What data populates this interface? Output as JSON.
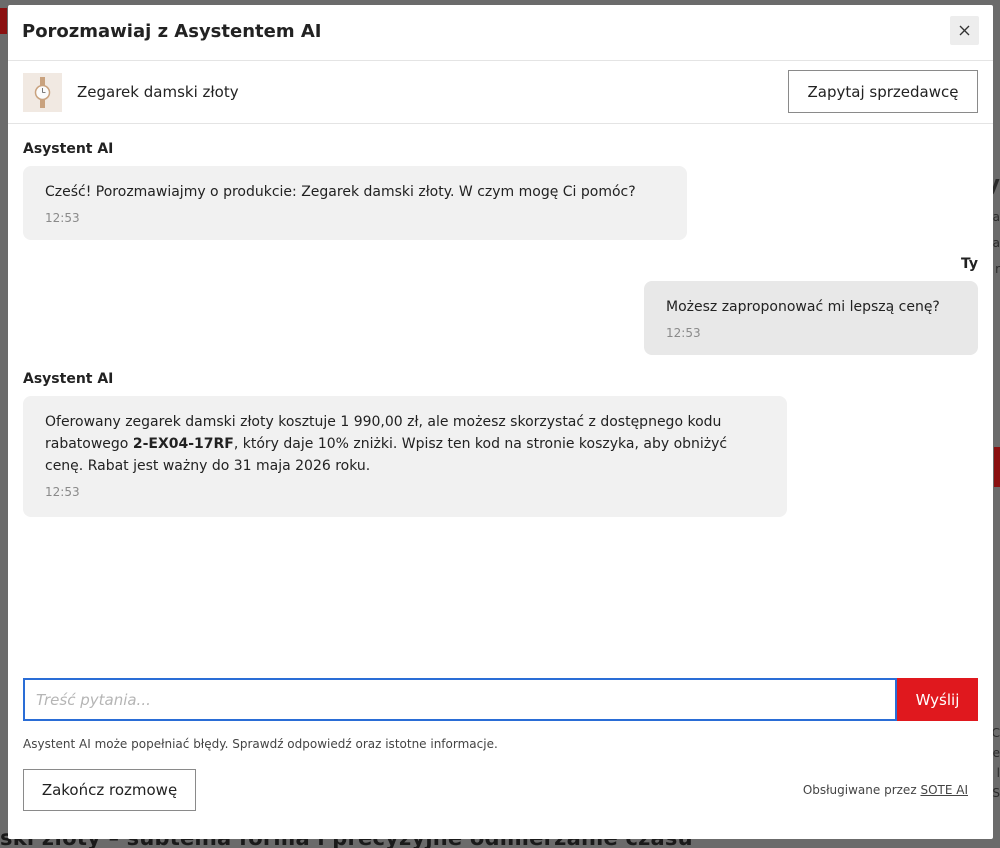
{
  "modal": {
    "title": "Porozmawiaj z Asystentem AI",
    "close_icon": "close-icon"
  },
  "product": {
    "thumbnail_icon": "watch-thumbnail",
    "name": "Zegarek damski złoty",
    "ask_seller_label": "Zapytaj sprzedawcę"
  },
  "messages": [
    {
      "sender": "Asystent AI",
      "text": "Cześć! Porozmawiajmy o produkcie: Zegarek damski złoty. W czym mogę Ci pomóc?",
      "time": "12:53"
    },
    {
      "sender": "Ty",
      "text": "Możesz zaproponować mi lepszą cenę?",
      "time": "12:53"
    },
    {
      "sender": "Asystent AI",
      "text_before": "Oferowany zegarek damski złoty kosztuje 1 990,00 zł, ale możesz skorzystać z dostępnego kodu rabatowego ",
      "code": "2-EX04-17RF",
      "text_after": ", który daje 10% zniżki. Wpisz ten kod na stronie koszyka, aby obniżyć cenę. Rabat jest ważny do 31 maja 2026 roku.",
      "time": "12:53"
    }
  ],
  "input": {
    "placeholder": "Treść pytania...",
    "value": "",
    "send_label": "Wyślij"
  },
  "footer": {
    "disclaimer": "Asystent AI może popełniać błędy. Sprawdź odpowiedź oraz istotne informacje.",
    "end_chat_label": "Zakończ rozmowę",
    "powered_by_prefix": "Obsługiwane przez",
    "powered_by_link": "SOTE AI"
  },
  "background": {
    "bottom_text": "ski złoty – subtelna forma i precyzyjne odmierzanie czasu",
    "right_fragments": [
      "y",
      "a",
      "a",
      "r",
      "C",
      "e",
      "l",
      "S",
      "t",
      "e",
      "e"
    ]
  },
  "colors": {
    "accent_red": "#e0181e",
    "focus_blue": "#2a6dd6",
    "bubble_bg": "#f1f1f1"
  }
}
